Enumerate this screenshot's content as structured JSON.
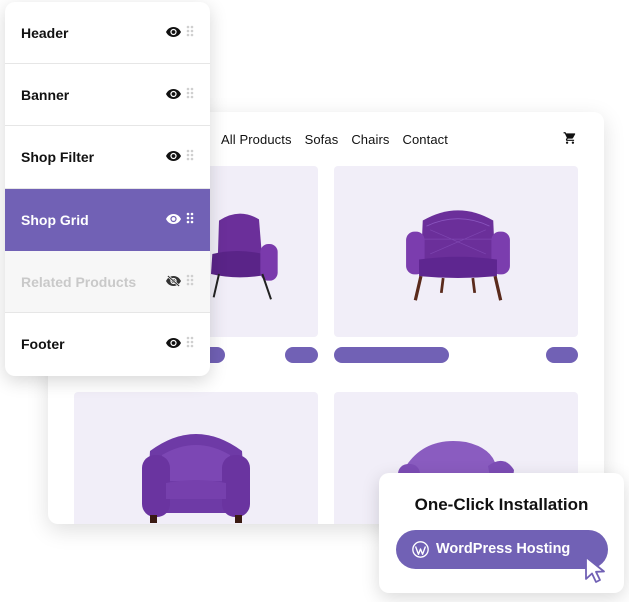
{
  "nav": {
    "items": [
      "All Products",
      "Sofas",
      "Chairs",
      "Contact"
    ],
    "cart_icon": "cart-icon"
  },
  "panel": {
    "sections": [
      {
        "label": "Header",
        "visible": true,
        "icon": "eye-icon"
      },
      {
        "label": "Banner",
        "visible": true,
        "icon": "eye-icon"
      },
      {
        "label": "Shop Filter",
        "visible": true,
        "icon": "eye-icon"
      },
      {
        "label": "Shop Grid",
        "visible": true,
        "icon": "eye-icon",
        "active": true
      },
      {
        "label": "Related Products",
        "visible": false,
        "icon": "eye-off-icon"
      },
      {
        "label": "Footer",
        "visible": true,
        "icon": "eye-icon"
      }
    ]
  },
  "install": {
    "title": "One-Click Installation",
    "button_label": "WordPress Hosting",
    "button_icon": "wordpress-icon"
  },
  "colors": {
    "accent": "#7161b5",
    "tile_bg": "#f1eef8",
    "chair_purple": "#6b3a9c"
  }
}
